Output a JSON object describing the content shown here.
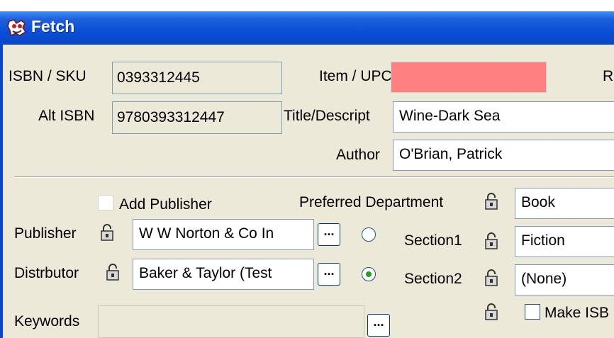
{
  "window": {
    "title": "Fetch"
  },
  "fields": {
    "isbn_label": "ISBN / SKU",
    "isbn_value": "0393312445",
    "alt_isbn_label": "Alt ISBN",
    "alt_isbn_value": "9780393312447",
    "item_upc_label": "Item / UPC",
    "item_upc_value": "",
    "item_upc_color": "#ff8080",
    "right_cut_label": "R",
    "title_label": "Title/Descript",
    "title_value": "Wine-Dark Sea",
    "author_label": "Author",
    "author_value": "O'Brian, Patrick"
  },
  "publisher_section": {
    "add_publisher_label": "Add Publisher",
    "publisher_label": "Publisher",
    "publisher_value": "W W Norton & Co In",
    "distributor_label": "Distrbutor",
    "distributor_value": "Baker & Taylor (Test",
    "keywords_label": "Keywords",
    "keywords_value": "",
    "browse_label": "...",
    "publisher_radio_selected": false,
    "distributor_radio_selected": true
  },
  "department_section": {
    "preferred_department_label": "Preferred Department",
    "preferred_department_value": "Book",
    "section1_label": "Section1",
    "section1_value": "Fiction",
    "section2_label": "Section2",
    "section2_value": "(None)",
    "make_isbn_label": "Make ISB"
  },
  "icons": {
    "app": "fetch-dog-icon",
    "lock": "padlock-icon"
  }
}
